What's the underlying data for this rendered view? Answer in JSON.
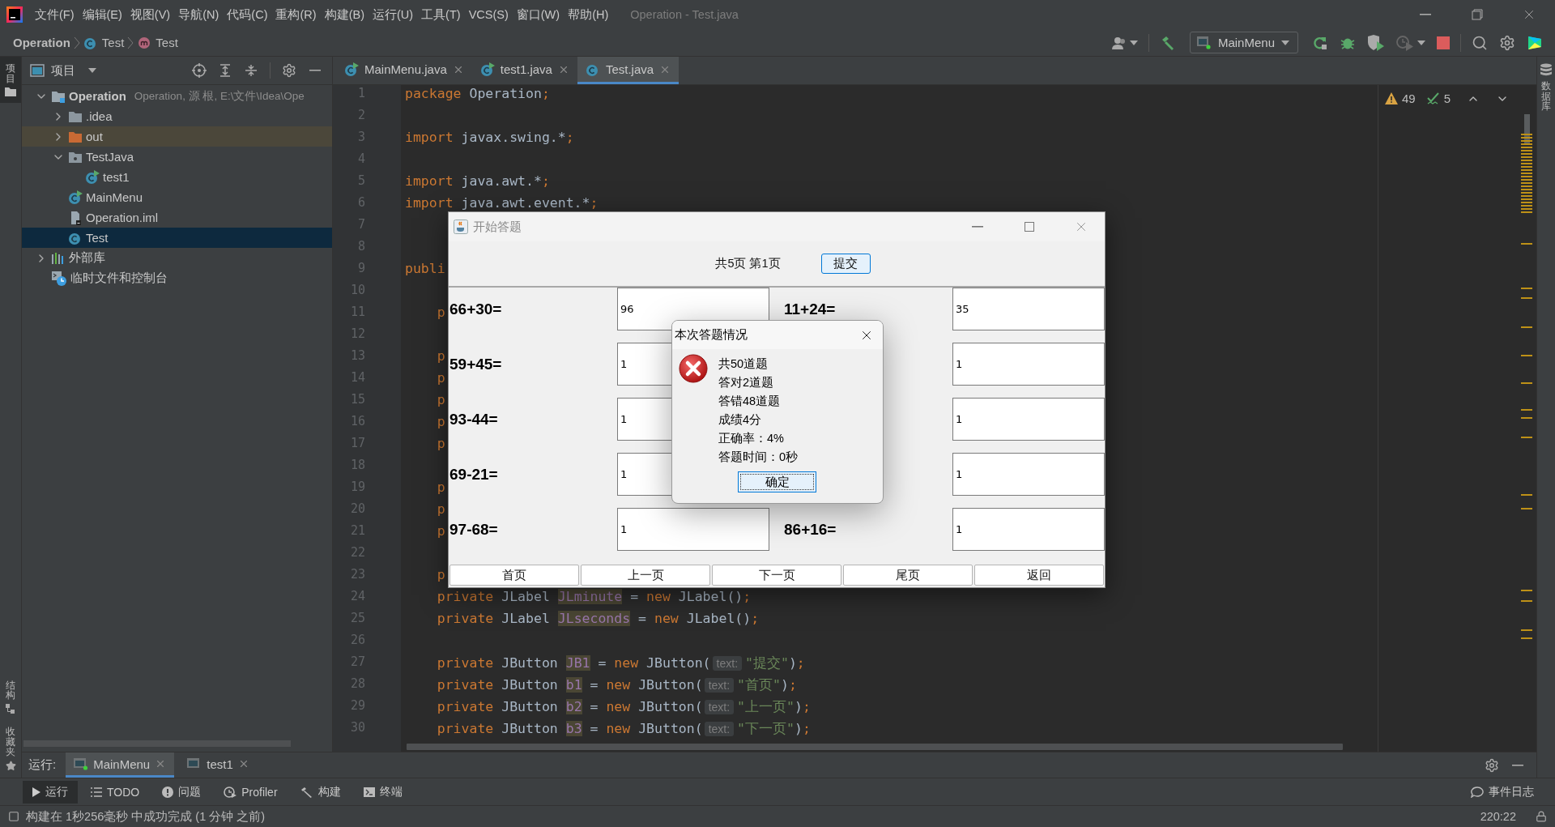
{
  "menu_bar": {
    "items": [
      "文件(F)",
      "编辑(E)",
      "视图(V)",
      "导航(N)",
      "代码(C)",
      "重构(R)",
      "构建(B)",
      "运行(U)",
      "工具(T)",
      "VCS(S)",
      "窗口(W)",
      "帮助(H)"
    ],
    "title": "Operation - Test.java"
  },
  "breadcrumb": [
    {
      "label": "Operation",
      "kind": "project"
    },
    {
      "label": "Test",
      "kind": "class"
    },
    {
      "label": "Test",
      "kind": "method"
    }
  ],
  "toolbar": {
    "run_config": "MainMenu"
  },
  "left_strip": {
    "top": [
      {
        "label": "项目",
        "kind": "project",
        "selected": true
      }
    ],
    "bottom": [
      {
        "label": "结构",
        "kind": "structure",
        "selected": false
      },
      {
        "label": "收藏夹",
        "kind": "favorites",
        "selected": false
      }
    ]
  },
  "right_strip": [
    {
      "label": "数据库",
      "kind": "database"
    }
  ],
  "project_panel": {
    "title": "项目",
    "tree": [
      {
        "label": "Operation",
        "detail": "Operation, 源 根, E:\\文件\\Idea\\Ope",
        "kind": "module",
        "expanded": true,
        "selected": false,
        "highlighted": false,
        "children": [
          {
            "label": ".idea",
            "kind": "folder",
            "expanded": false,
            "selected": false,
            "highlighted": false
          },
          {
            "label": "out",
            "kind": "excluded-folder",
            "expanded": false,
            "selected": false,
            "highlighted": true
          },
          {
            "label": "TestJava",
            "kind": "source-folder",
            "expanded": true,
            "selected": false,
            "highlighted": false,
            "children": [
              {
                "label": "test1",
                "kind": "run-class",
                "selected": false,
                "highlighted": false
              }
            ]
          },
          {
            "label": "MainMenu",
            "kind": "run-class",
            "selected": false,
            "highlighted": false
          },
          {
            "label": "Operation.iml",
            "kind": "file",
            "selected": false,
            "highlighted": false
          },
          {
            "label": "Test",
            "kind": "class",
            "selected": true,
            "highlighted": false
          }
        ]
      },
      {
        "label": "外部库",
        "kind": "library",
        "expanded": false,
        "selected": false,
        "highlighted": false
      },
      {
        "label": "临时文件和控制台",
        "kind": "scratch",
        "selected": false,
        "highlighted": false
      }
    ]
  },
  "editor_tabs": [
    {
      "label": "MainMenu.java",
      "kind": "run-class",
      "selected": false
    },
    {
      "label": "test1.java",
      "kind": "run-class",
      "selected": false
    },
    {
      "label": "Test.java",
      "kind": "class",
      "selected": true
    }
  ],
  "inspections": {
    "warnings": "49",
    "weak_warnings": "5"
  },
  "code_lines": [
    {
      "number": "1",
      "indented": false,
      "tokens": [
        {
          "kind": "keyword",
          "text": "package "
        },
        {
          "kind": "plain",
          "text": "Operation"
        },
        {
          "kind": "keyword",
          "text": ";"
        }
      ]
    },
    {
      "number": "2"
    },
    {
      "number": "3",
      "indented": false,
      "tokens": [
        {
          "kind": "keyword",
          "text": "import "
        },
        {
          "kind": "plain",
          "text": "javax.swing.*"
        },
        {
          "kind": "keyword",
          "text": ";"
        }
      ]
    },
    {
      "number": "4"
    },
    {
      "number": "5",
      "indented": false,
      "tokens": [
        {
          "kind": "keyword",
          "text": "import "
        },
        {
          "kind": "plain",
          "text": "java.awt.*"
        },
        {
          "kind": "keyword",
          "text": ";"
        }
      ]
    },
    {
      "number": "6",
      "indented": false,
      "tokens": [
        {
          "kind": "keyword",
          "text": "import "
        },
        {
          "kind": "plain",
          "text": "java.awt.event.*"
        },
        {
          "kind": "keyword",
          "text": ";"
        }
      ]
    },
    {
      "number": "7"
    },
    {
      "number": "8"
    },
    {
      "number": "9",
      "indented": false,
      "tokens": [
        {
          "kind": "keyword",
          "text": "publi"
        }
      ]
    },
    {
      "number": "10"
    },
    {
      "number": "11",
      "indented": true,
      "tokens": [
        {
          "kind": "keyword",
          "text": "p"
        }
      ]
    },
    {
      "number": "12"
    },
    {
      "number": "13",
      "indented": true,
      "tokens": [
        {
          "kind": "keyword",
          "text": "p"
        }
      ]
    },
    {
      "number": "14",
      "indented": true,
      "tokens": [
        {
          "kind": "keyword",
          "text": "p"
        }
      ]
    },
    {
      "number": "15",
      "indented": true,
      "tokens": [
        {
          "kind": "keyword",
          "text": "p"
        }
      ]
    },
    {
      "number": "16",
      "indented": true,
      "tokens": [
        {
          "kind": "keyword",
          "text": "p"
        }
      ]
    },
    {
      "number": "17",
      "indented": true,
      "tokens": [
        {
          "kind": "keyword",
          "text": "p"
        }
      ]
    },
    {
      "number": "18"
    },
    {
      "number": "19",
      "indented": true,
      "tokens": [
        {
          "kind": "keyword",
          "text": "p"
        }
      ]
    },
    {
      "number": "20",
      "indented": true,
      "tokens": [
        {
          "kind": "keyword",
          "text": "p"
        }
      ]
    },
    {
      "number": "21",
      "indented": true,
      "tokens": [
        {
          "kind": "keyword",
          "text": "p"
        }
      ]
    },
    {
      "number": "22"
    },
    {
      "number": "23",
      "indented": true,
      "tokens": [
        {
          "kind": "keyword",
          "text": "p"
        }
      ]
    },
    {
      "number": "24",
      "indented": true,
      "tokens": [
        {
          "kind": "keyword",
          "text": "private "
        },
        {
          "kind": "plain",
          "text": "JLabel "
        },
        {
          "kind": "field",
          "text": "JLminute"
        },
        {
          "kind": "plain",
          "text": " = "
        },
        {
          "kind": "keyword",
          "text": "new "
        },
        {
          "kind": "plain",
          "text": "JLabel()"
        },
        {
          "kind": "keyword",
          "text": ";"
        }
      ]
    },
    {
      "number": "25",
      "indented": true,
      "tokens": [
        {
          "kind": "keyword",
          "text": "private "
        },
        {
          "kind": "plain",
          "text": "JLabel "
        },
        {
          "kind": "field",
          "text": "JLseconds"
        },
        {
          "kind": "plain",
          "text": " = "
        },
        {
          "kind": "keyword",
          "text": "new "
        },
        {
          "kind": "plain",
          "text": "JLabel()"
        },
        {
          "kind": "keyword",
          "text": ";"
        }
      ]
    },
    {
      "number": "26"
    },
    {
      "number": "27",
      "indented": true,
      "tokens": [
        {
          "kind": "keyword",
          "text": "private "
        },
        {
          "kind": "plain",
          "text": "JButton "
        },
        {
          "kind": "field",
          "text": "JB1"
        },
        {
          "kind": "plain",
          "text": " = "
        },
        {
          "kind": "keyword",
          "text": "new "
        },
        {
          "kind": "plain",
          "text": "JButton("
        },
        {
          "kind": "hint",
          "text": "text:"
        },
        {
          "kind": "string",
          "text": "\"提交\""
        },
        {
          "kind": "plain",
          "text": ")"
        },
        {
          "kind": "keyword",
          "text": ";"
        }
      ]
    },
    {
      "number": "28",
      "indented": true,
      "tokens": [
        {
          "kind": "keyword",
          "text": "private "
        },
        {
          "kind": "plain",
          "text": "JButton "
        },
        {
          "kind": "field",
          "text": "b1"
        },
        {
          "kind": "plain",
          "text": " = "
        },
        {
          "kind": "keyword",
          "text": "new "
        },
        {
          "kind": "plain",
          "text": "JButton("
        },
        {
          "kind": "hint",
          "text": "text:"
        },
        {
          "kind": "string",
          "text": "\"首页\""
        },
        {
          "kind": "plain",
          "text": ")"
        },
        {
          "kind": "keyword",
          "text": ";"
        }
      ]
    },
    {
      "number": "29",
      "indented": true,
      "tokens": [
        {
          "kind": "keyword",
          "text": "private "
        },
        {
          "kind": "plain",
          "text": "JButton "
        },
        {
          "kind": "field",
          "text": "b2"
        },
        {
          "kind": "plain",
          "text": " = "
        },
        {
          "kind": "keyword",
          "text": "new "
        },
        {
          "kind": "plain",
          "text": "JButton("
        },
        {
          "kind": "hint",
          "text": "text:"
        },
        {
          "kind": "string",
          "text": "\"上一页\""
        },
        {
          "kind": "plain",
          "text": ")"
        },
        {
          "kind": "keyword",
          "text": ";"
        }
      ]
    },
    {
      "number": "30",
      "indented": true,
      "tokens": [
        {
          "kind": "keyword",
          "text": "private "
        },
        {
          "kind": "plain",
          "text": "JButton "
        },
        {
          "kind": "field",
          "text": "b3"
        },
        {
          "kind": "plain",
          "text": " = "
        },
        {
          "kind": "keyword",
          "text": "new "
        },
        {
          "kind": "plain",
          "text": "JButton("
        },
        {
          "kind": "hint",
          "text": "text:"
        },
        {
          "kind": "string",
          "text": "\"下一页\""
        },
        {
          "kind": "plain",
          "text": ")"
        },
        {
          "kind": "keyword",
          "text": ";"
        }
      ]
    }
  ],
  "quiz_window": {
    "title": "开始答题",
    "page_info": "共5页 第1页",
    "submit": "提交",
    "rows": [
      {
        "left": {
          "question": "66+30=",
          "answer": "96"
        },
        "right": {
          "question": "11+24=",
          "answer": "35"
        }
      },
      {
        "left": {
          "question": "59+45=",
          "answer": "1"
        },
        "right": {
          "answer": "1"
        }
      },
      {
        "left": {
          "question": "93-44=",
          "answer": "1"
        },
        "right": {
          "answer": "1"
        }
      },
      {
        "left": {
          "question": "69-21=",
          "answer": "1"
        },
        "right": {
          "answer": "1"
        }
      },
      {
        "left": {
          "question": "97-68=",
          "answer": "1"
        },
        "right": {
          "question": "86+16=",
          "answer": "1"
        }
      }
    ],
    "nav_buttons": [
      "首页",
      "上一页",
      "下一页",
      "尾页",
      "返回"
    ]
  },
  "result_dialog": {
    "title": "本次答题情况",
    "lines": [
      "共50道题",
      "答对2道题",
      "答错48道题",
      "成绩4分",
      "正确率：4%",
      "答题时间：0秒"
    ],
    "button": "确定"
  },
  "run_panel": {
    "label": "运行:",
    "tabs": [
      {
        "label": "MainMenu",
        "selected": true,
        "running": true
      },
      {
        "label": "test1",
        "selected": false,
        "running": false
      }
    ]
  },
  "tool_tabs": [
    {
      "label": "运行",
      "kind": "run",
      "selected": true
    },
    {
      "label": "TODO",
      "kind": "todo",
      "selected": false
    },
    {
      "label": "问题",
      "kind": "problems",
      "selected": false
    },
    {
      "label": "Profiler",
      "kind": "profiler",
      "selected": false
    },
    {
      "label": "构建",
      "kind": "build",
      "selected": false
    },
    {
      "label": "终端",
      "kind": "terminal",
      "selected": false
    }
  ],
  "event_log": "事件日志",
  "status_bar": {
    "message": "构建在 1秒256毫秒 中成功完成 (1 分钟 之前)",
    "position": "220:22"
  }
}
